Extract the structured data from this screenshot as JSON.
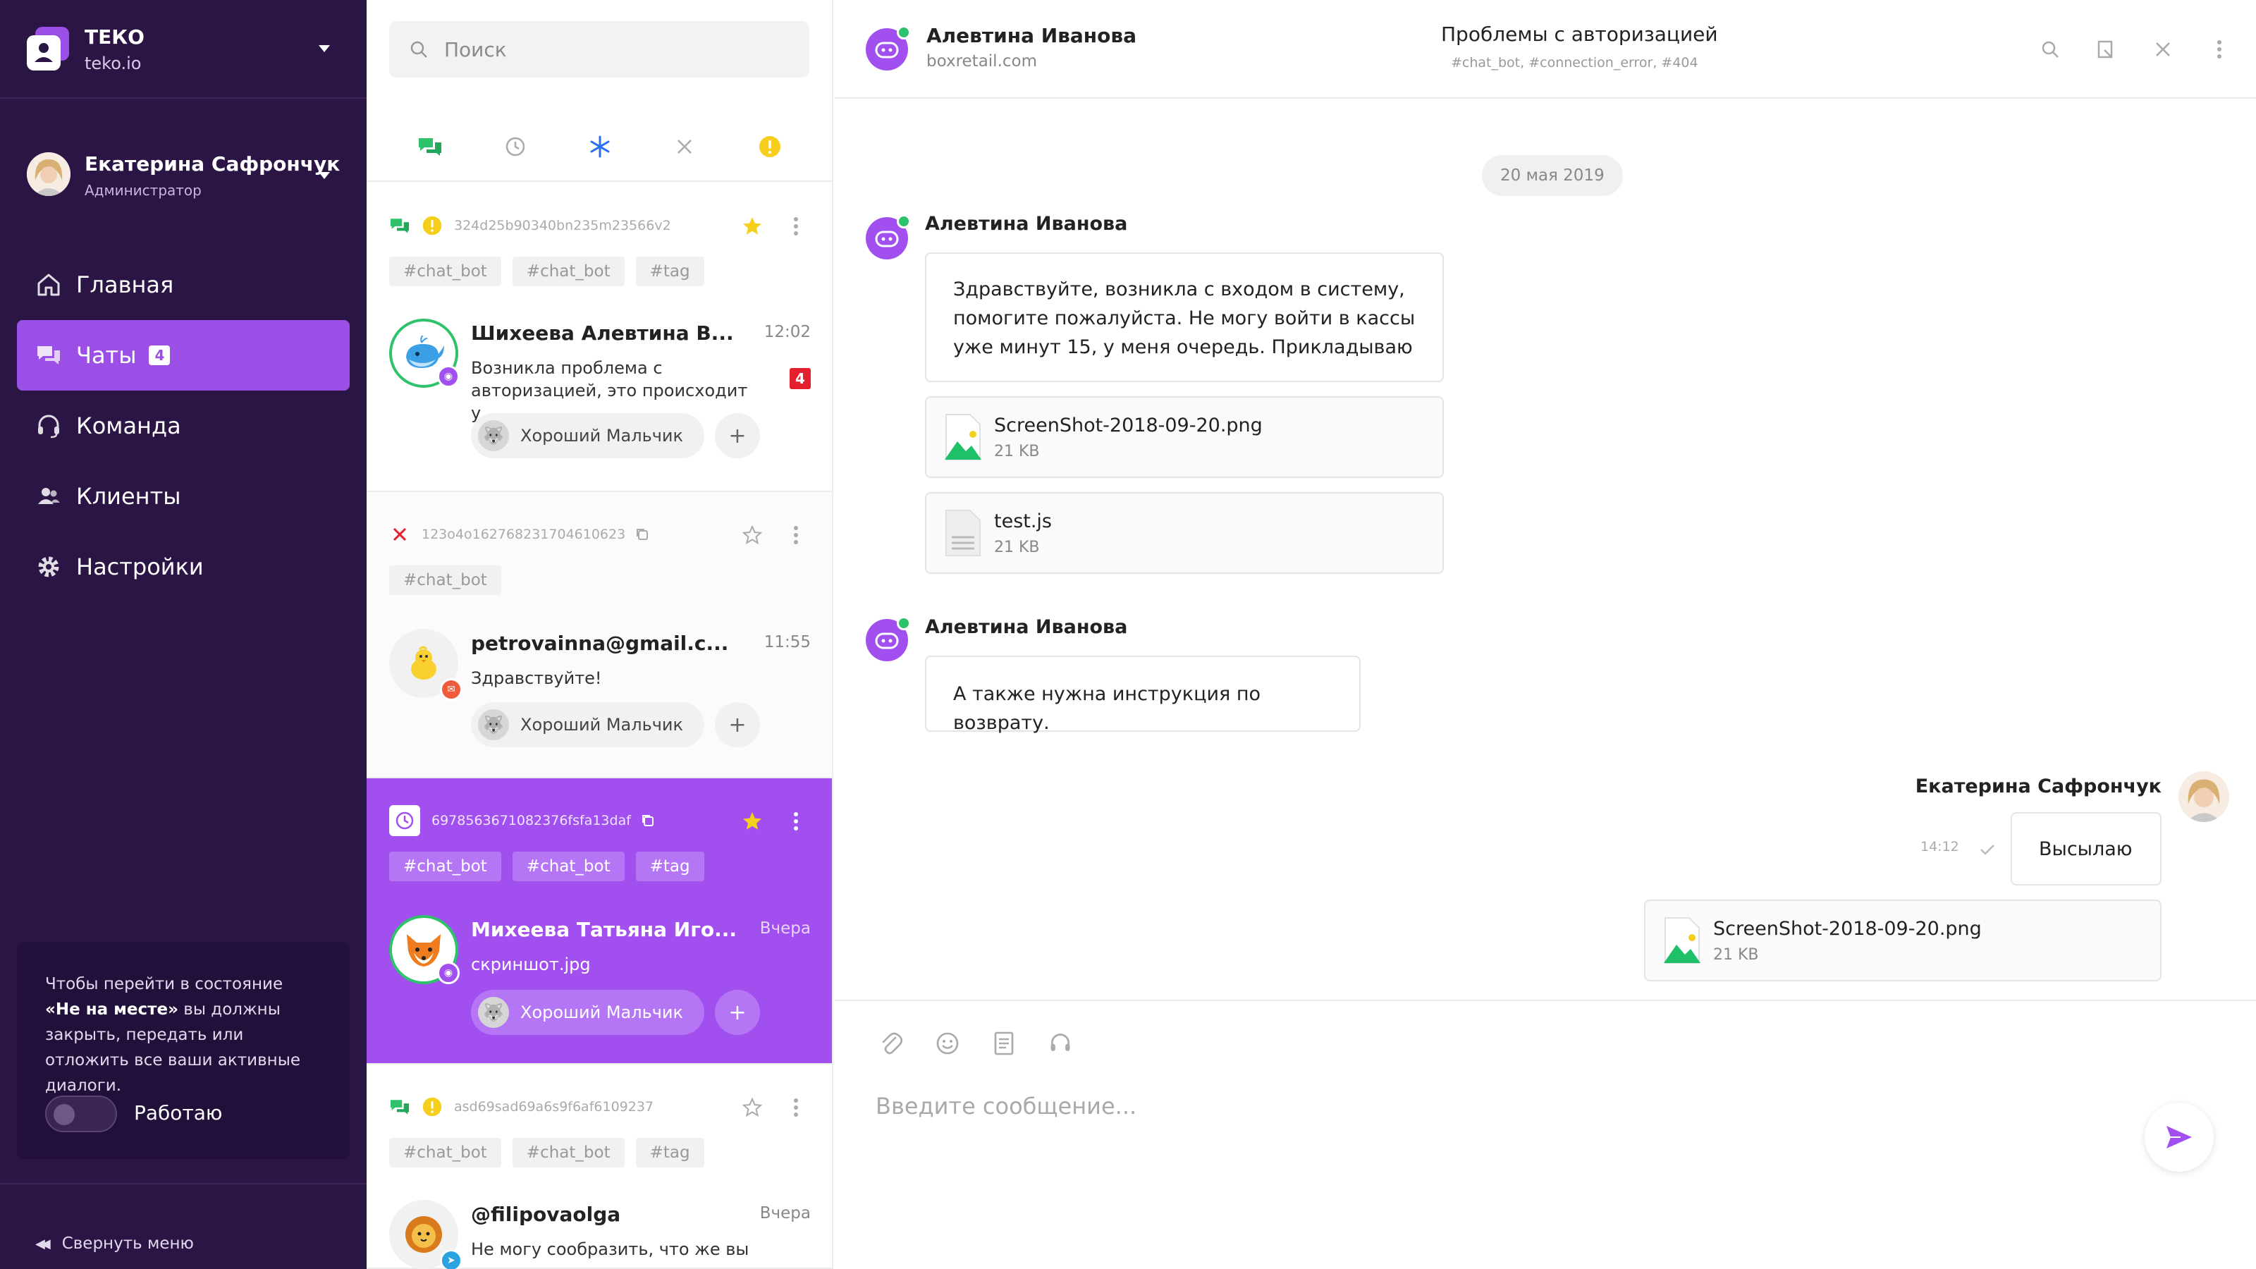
{
  "sidebar": {
    "org_name": "ТЕКО",
    "org_domain": "teko.io",
    "user_name": "Екатерина Сафрончук",
    "user_role": "Администратор",
    "nav": [
      {
        "label": "Главная",
        "icon": "home-icon"
      },
      {
        "label": "Чаты",
        "icon": "chats-icon",
        "badge": "4",
        "active": true
      },
      {
        "label": "Команда",
        "icon": "headset-icon"
      },
      {
        "label": "Клиенты",
        "icon": "clients-icon"
      },
      {
        "label": "Настройки",
        "icon": "gear-icon"
      }
    ],
    "status_text_1": "Чтобы перейти в состояние ",
    "status_text_bold": "«Не на месте»",
    "status_text_2": " вы должны закрыть, передать или отложить все ваши активные диалоги.",
    "toggle_label": "Работаю",
    "collapse_label": "Свернуть меню"
  },
  "list": {
    "search_placeholder": "Поиск",
    "conversations": [
      {
        "id": "324d25b90340bn235m23566v2",
        "tags": [
          "#chat_bot",
          "#chat_bot",
          "#tag"
        ],
        "name": "Шихеева Алевтина В...",
        "time": "12:02",
        "preview": "Возникла проблема с авторизацией, это происходит у...",
        "unread": "4",
        "assignee": "Хороший Мальчик"
      },
      {
        "id": "123o4o162768231704610623",
        "tags": [
          "#chat_bot"
        ],
        "name": "petrovainna@gmail.c...",
        "time": "11:55",
        "preview": "Здравствуйте!",
        "assignee": "Хороший Мальчик"
      },
      {
        "id": "6978563671082376fsfa13daf",
        "tags": [
          "#chat_bot",
          "#chat_bot",
          "#tag"
        ],
        "name": "Михеева Татьяна Иго...",
        "time": "Вчера",
        "preview": "скриншот.jpg",
        "assignee": "Хороший Мальчик"
      },
      {
        "id": "asd69sad69a6s9f6af6109237",
        "tags": [
          "#chat_bot",
          "#chat_bot",
          "#tag"
        ],
        "name": "@filipovaolga",
        "time": "Вчера",
        "preview": "Не могу сообразить, что же вы"
      }
    ],
    "add_label": "+"
  },
  "chat": {
    "contact_name": "Алевтина Иванова",
    "contact_site": "boxretail.com",
    "subject": "Проблемы с авторизацией",
    "subject_tags": "#chat_bot, #connection_error, #404",
    "date": "20 мая 2019",
    "msg1_author": "Алевтина Иванова",
    "msg1_text": "Здравствуйте, возникла с входом в систему, помогите пожалуйста. Не могу войти в кассы уже минут 15, у меня очередь. Прикладываю",
    "file1_name": "ScreenShot-2018-09-20.png",
    "file1_size": "21 KB",
    "file2_name": "test.js",
    "file2_size": "21 KB",
    "msg2_author": "Алевтина Иванова",
    "msg2_text": "А также нужна инструкция по возврату.",
    "msg3_author": "Екатерина Сафрончук",
    "msg3_time": "14:12",
    "msg3_text": "Высылаю",
    "file3_name": "ScreenShot-2018-09-20.png",
    "file3_size": "21 KB",
    "composer_placeholder": "Введите сообщение..."
  },
  "colors": {
    "sidebar_bg": "#2b1545",
    "accent": "#a24ff0",
    "online": "#2ec26a",
    "unread": "#e5202e",
    "warning": "#f6cf1d"
  }
}
